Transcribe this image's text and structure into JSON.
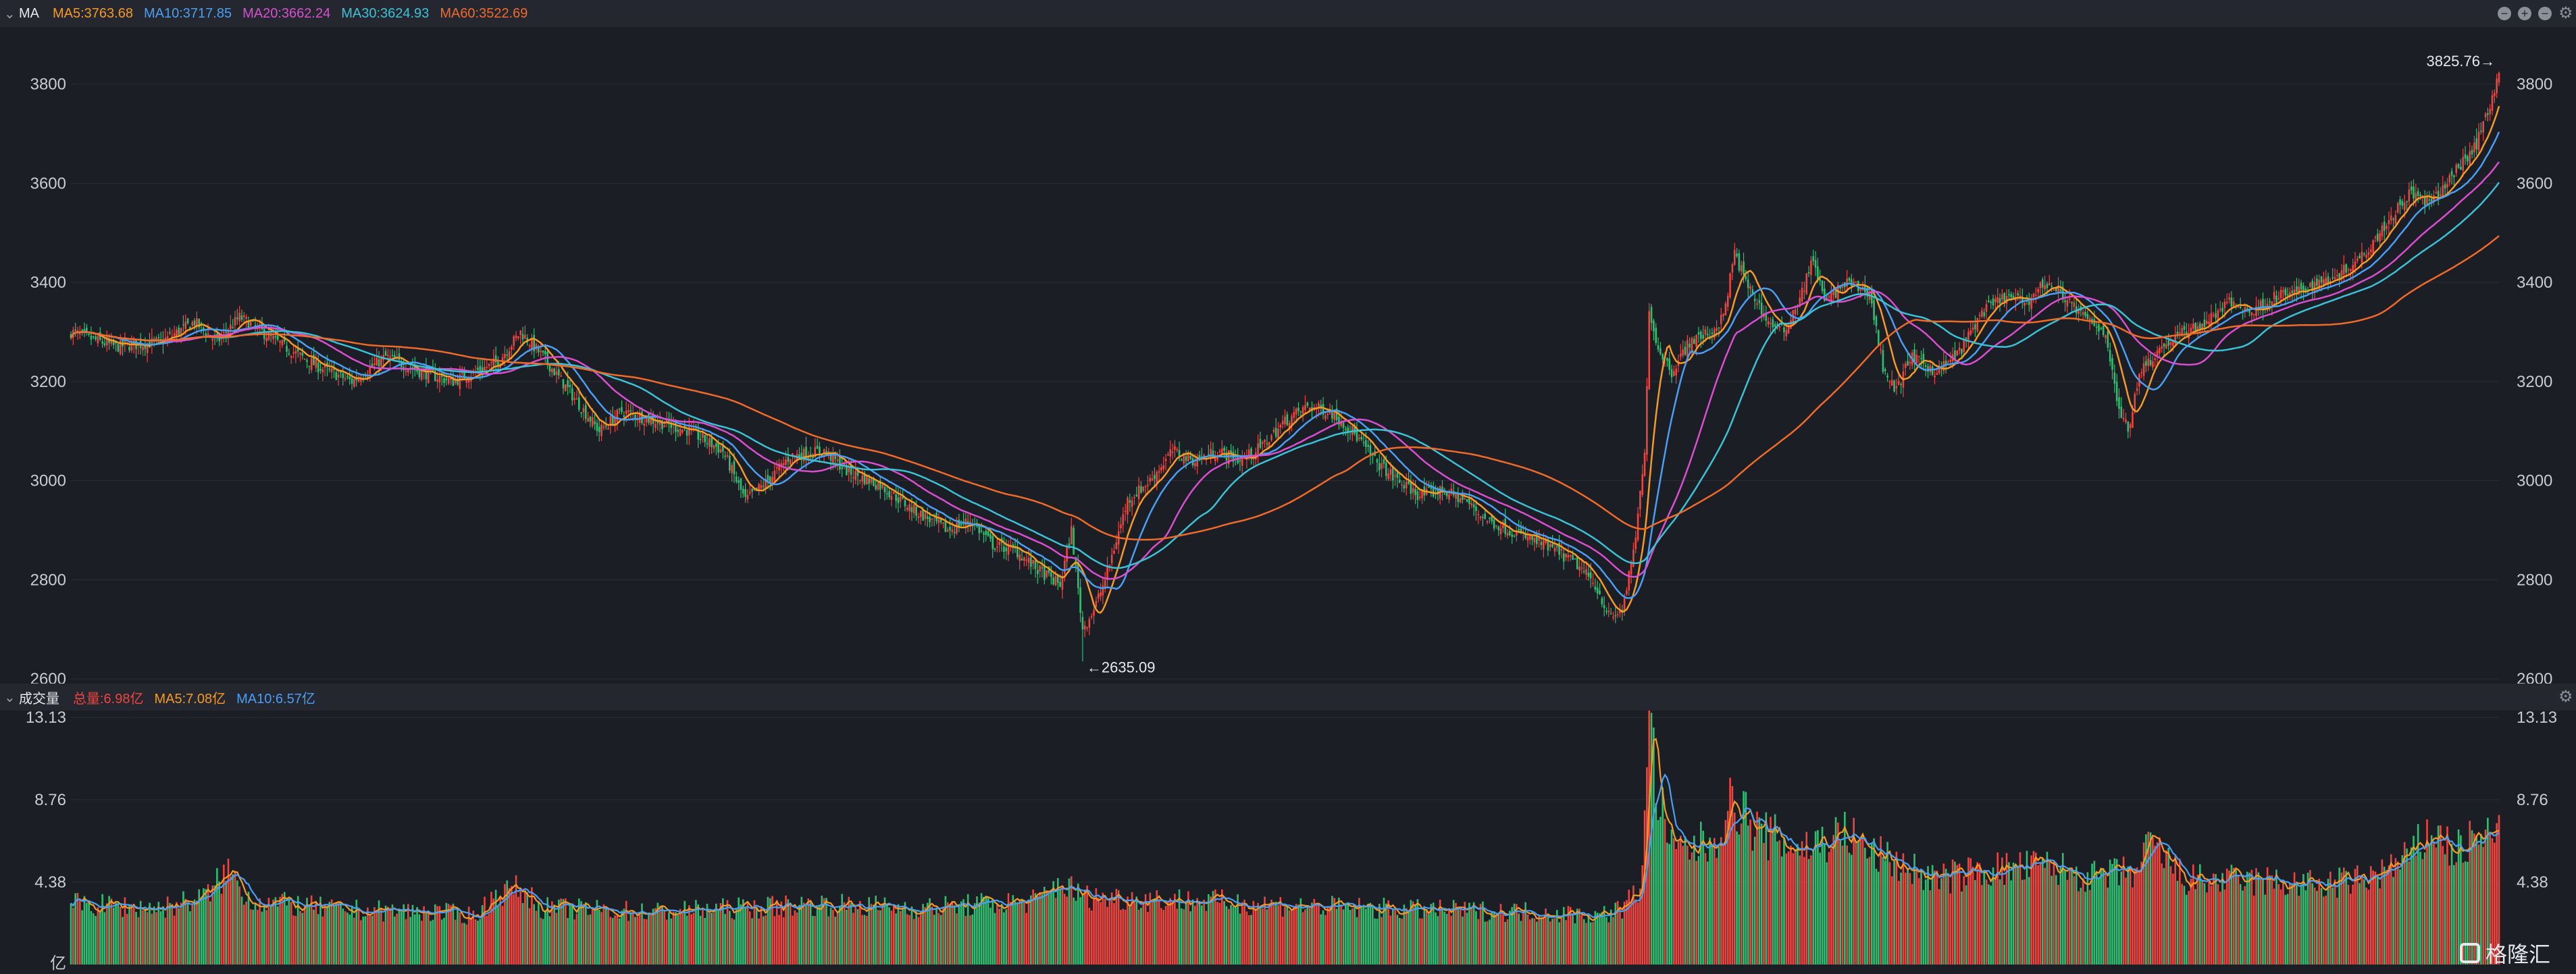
{
  "price_panel": {
    "title": "MA",
    "indicators": [
      {
        "label": "MA5:3763.68",
        "color": "#f59a23"
      },
      {
        "label": "MA10:3717.85",
        "color": "#4a9ff5"
      },
      {
        "label": "MA20:3662.24",
        "color": "#d94fd0"
      },
      {
        "label": "MA30:3624.93",
        "color": "#3bc2d6"
      },
      {
        "label": "MA60:3522.69",
        "color": "#f06a2a"
      }
    ],
    "high_label": "3825.76→",
    "low_label": "←2635.09",
    "controls": [
      "minus-icon",
      "plus-icon",
      "minus-icon",
      "gear-icon"
    ]
  },
  "volume_panel": {
    "title": "成交量",
    "indicators": [
      {
        "label": "总量:6.98亿",
        "color": "#f0453f"
      },
      {
        "label": "MA5:7.08亿",
        "color": "#f59a23"
      },
      {
        "label": "MA10:6.57亿",
        "color": "#4a9ff5"
      }
    ],
    "unit_label": "亿"
  },
  "watermark": "格隆汇",
  "colors": {
    "up": "#f0453f",
    "down": "#2fbf71",
    "grid": "#2b2e37",
    "axis_text": "#c9ccd3",
    "background": "#1c1e25"
  },
  "chart_data": [
    {
      "type": "candlestick",
      "ylim": [
        2600,
        3850
      ],
      "yticks": [
        2600,
        2800,
        3000,
        3200,
        3400,
        3600,
        3800
      ],
      "high_point": 3825.76,
      "low_point": 2635.09,
      "close_anchors": [
        [
          0,
          3300
        ],
        [
          20,
          3270
        ],
        [
          40,
          3280
        ],
        [
          55,
          3320
        ],
        [
          65,
          3280
        ],
        [
          75,
          3330
        ],
        [
          95,
          3270
        ],
        [
          110,
          3230
        ],
        [
          125,
          3200
        ],
        [
          140,
          3250
        ],
        [
          155,
          3220
        ],
        [
          170,
          3200
        ],
        [
          190,
          3240
        ],
        [
          200,
          3300
        ],
        [
          210,
          3250
        ],
        [
          225,
          3160
        ],
        [
          235,
          3100
        ],
        [
          245,
          3140
        ],
        [
          260,
          3120
        ],
        [
          275,
          3100
        ],
        [
          290,
          3060
        ],
        [
          300,
          2960
        ],
        [
          310,
          3000
        ],
        [
          320,
          3050
        ],
        [
          335,
          3060
        ],
        [
          345,
          3020
        ],
        [
          360,
          2990
        ],
        [
          375,
          2940
        ],
        [
          390,
          2900
        ],
        [
          400,
          2920
        ],
        [
          410,
          2870
        ],
        [
          420,
          2860
        ],
        [
          430,
          2820
        ],
        [
          440,
          2790
        ],
        [
          445,
          2900
        ],
        [
          450,
          2700
        ],
        [
          455,
          2740
        ],
        [
          460,
          2800
        ],
        [
          470,
          2960
        ],
        [
          480,
          3000
        ],
        [
          490,
          3060
        ],
        [
          500,
          3040
        ],
        [
          510,
          3060
        ],
        [
          520,
          3040
        ],
        [
          530,
          3070
        ],
        [
          540,
          3120
        ],
        [
          550,
          3150
        ],
        [
          560,
          3140
        ],
        [
          570,
          3100
        ],
        [
          580,
          3040
        ],
        [
          590,
          3000
        ],
        [
          600,
          2970
        ],
        [
          610,
          2980
        ],
        [
          620,
          2960
        ],
        [
          630,
          2920
        ],
        [
          640,
          2900
        ],
        [
          650,
          2880
        ],
        [
          660,
          2860
        ],
        [
          670,
          2830
        ],
        [
          678,
          2790
        ],
        [
          685,
          2720
        ],
        [
          690,
          2740
        ],
        [
          695,
          2850
        ],
        [
          700,
          3050
        ],
        [
          702,
          3350
        ],
        [
          705,
          3280
        ],
        [
          712,
          3220
        ],
        [
          720,
          3280
        ],
        [
          730,
          3300
        ],
        [
          735,
          3330
        ],
        [
          740,
          3460
        ],
        [
          745,
          3400
        ],
        [
          755,
          3320
        ],
        [
          762,
          3300
        ],
        [
          770,
          3380
        ],
        [
          775,
          3450
        ],
        [
          780,
          3360
        ],
        [
          790,
          3400
        ],
        [
          800,
          3380
        ],
        [
          806,
          3230
        ],
        [
          812,
          3180
        ],
        [
          818,
          3250
        ],
        [
          830,
          3220
        ],
        [
          840,
          3260
        ],
        [
          850,
          3340
        ],
        [
          860,
          3370
        ],
        [
          870,
          3360
        ],
        [
          878,
          3400
        ],
        [
          885,
          3380
        ],
        [
          895,
          3330
        ],
        [
          905,
          3300
        ],
        [
          910,
          3160
        ],
        [
          915,
          3100
        ],
        [
          920,
          3220
        ],
        [
          930,
          3270
        ],
        [
          940,
          3300
        ],
        [
          950,
          3320
        ],
        [
          960,
          3360
        ],
        [
          970,
          3340
        ],
        [
          980,
          3370
        ],
        [
          990,
          3380
        ],
        [
          1000,
          3400
        ],
        [
          1010,
          3420
        ],
        [
          1020,
          3460
        ],
        [
          1030,
          3520
        ],
        [
          1040,
          3580
        ],
        [
          1050,
          3560
        ],
        [
          1060,
          3620
        ],
        [
          1070,
          3680
        ],
        [
          1076,
          3760
        ],
        [
          1080,
          3826
        ]
      ],
      "ma_periods": [
        5,
        10,
        20,
        30,
        60
      ],
      "ma_last_values": [
        3763.68,
        3717.85,
        3662.24,
        3624.93,
        3522.69
      ]
    },
    {
      "type": "volume-bar",
      "unit": "亿",
      "ylim": [
        0,
        13.13
      ],
      "yticks": [
        4.38,
        8.76,
        13.13
      ],
      "volume_anchors": [
        [
          0,
          3.2
        ],
        [
          40,
          3.0
        ],
        [
          60,
          3.6
        ],
        [
          70,
          5.0
        ],
        [
          80,
          3.4
        ],
        [
          120,
          2.9
        ],
        [
          160,
          2.8
        ],
        [
          180,
          2.6
        ],
        [
          190,
          3.8
        ],
        [
          200,
          4.0
        ],
        [
          210,
          3.0
        ],
        [
          260,
          2.8
        ],
        [
          300,
          3.0
        ],
        [
          330,
          3.2
        ],
        [
          380,
          3.0
        ],
        [
          430,
          3.4
        ],
        [
          440,
          4.4
        ],
        [
          450,
          3.6
        ],
        [
          500,
          3.4
        ],
        [
          550,
          3.1
        ],
        [
          600,
          2.9
        ],
        [
          650,
          2.8
        ],
        [
          680,
          2.6
        ],
        [
          690,
          3.0
        ],
        [
          698,
          4.0
        ],
        [
          702,
          13.13
        ],
        [
          706,
          9.0
        ],
        [
          712,
          6.0
        ],
        [
          730,
          6.5
        ],
        [
          740,
          8.8
        ],
        [
          750,
          7.0
        ],
        [
          770,
          6.2
        ],
        [
          790,
          7.0
        ],
        [
          800,
          6.0
        ],
        [
          830,
          4.5
        ],
        [
          850,
          5.0
        ],
        [
          880,
          5.2
        ],
        [
          900,
          4.6
        ],
        [
          920,
          5.0
        ],
        [
          925,
          6.5
        ],
        [
          940,
          4.5
        ],
        [
          980,
          4.4
        ],
        [
          1000,
          4.2
        ],
        [
          1020,
          4.5
        ],
        [
          1040,
          5.6
        ],
        [
          1050,
          7.2
        ],
        [
          1060,
          6.0
        ],
        [
          1070,
          6.6
        ],
        [
          1080,
          6.98
        ]
      ],
      "ma_last_values": [
        7.08,
        6.57
      ]
    }
  ]
}
